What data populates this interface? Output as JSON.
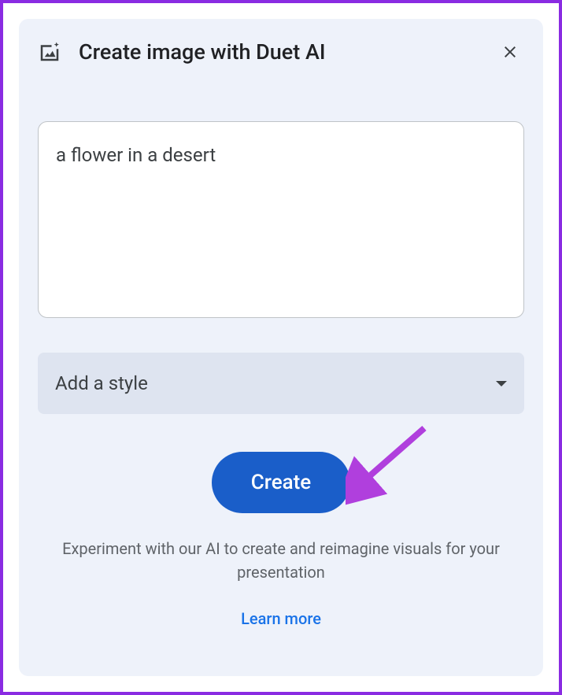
{
  "header": {
    "title": "Create image with Duet AI"
  },
  "prompt": {
    "value": "a flower in a desert"
  },
  "style_select": {
    "label": "Add a style"
  },
  "create_button": {
    "label": "Create"
  },
  "info_text": "Experiment with our AI to create and reimagine visuals for your presentation",
  "learn_more": {
    "label": "Learn more"
  }
}
